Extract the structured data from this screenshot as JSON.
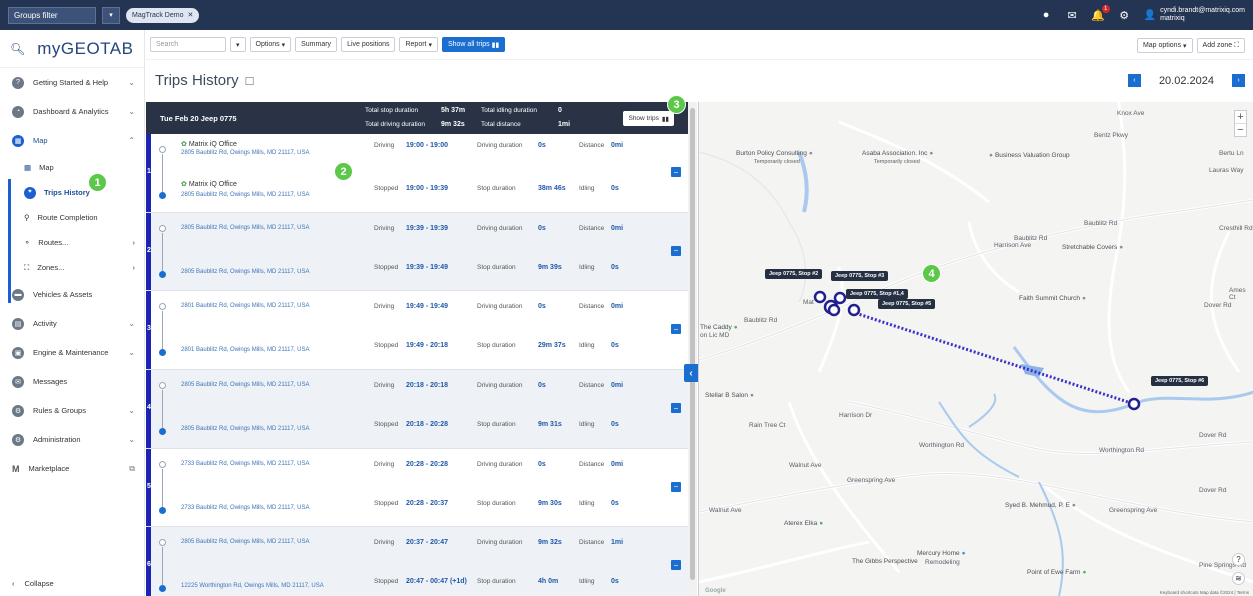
{
  "topbar": {
    "groups_filter": "Groups filter",
    "chip": "MagTrack Demo",
    "user_email": "cyndi.brandt@matrixiq.com",
    "user_org": "matrixiq",
    "notif_count": "1"
  },
  "logo": {
    "brand": "myGEOTAB",
    "tm": "™"
  },
  "sidebar": {
    "items": [
      {
        "label": "Getting Started & Help",
        "icon": "help-icon"
      },
      {
        "label": "Dashboard & Analytics",
        "icon": "dashboard-icon"
      },
      {
        "label": "Map",
        "icon": "map-icon"
      }
    ],
    "map_sub": [
      {
        "label": "Map"
      },
      {
        "label": "Trips History"
      },
      {
        "label": "Route Completion"
      },
      {
        "label": "Routes..."
      },
      {
        "label": "Zones..."
      }
    ],
    "items2": [
      {
        "label": "Vehicles & Assets"
      },
      {
        "label": "Activity"
      },
      {
        "label": "Engine & Maintenance"
      },
      {
        "label": "Messages"
      },
      {
        "label": "Rules & Groups"
      },
      {
        "label": "Administration"
      },
      {
        "label": "Marketplace"
      }
    ],
    "collapse": "Collapse"
  },
  "toolbar": {
    "search_placeholder": "Search",
    "options": "Options",
    "summary": "Summary",
    "live": "Live positions",
    "report": "Report",
    "show_all": "Show all trips",
    "map_options": "Map options",
    "add_zone": "Add zone"
  },
  "page": {
    "title": "Trips History",
    "date": "20.02.2024"
  },
  "panel": {
    "date_vehicle": "Tue Feb 20  Jeep 0775",
    "stats": {
      "stop_label": "Total stop duration",
      "stop_val": "5h 37m",
      "idle_label": "Total idling duration",
      "idle_val": "0",
      "drive_label": "Total driving duration",
      "drive_val": "9m 32s",
      "dist_label": "Total distance",
      "dist_val": "1mi"
    },
    "show_trips": "Show trips"
  },
  "labels": {
    "driving": "Driving",
    "stopped": "Stopped",
    "driving_duration": "Driving duration",
    "stop_duration": "Stop duration",
    "distance": "Distance",
    "idling": "Idling"
  },
  "trips": [
    {
      "n": "1",
      "start_name": "Matrix iQ Office",
      "start_addr": "2805 Baublitz Rd, Owings Mills, MD 21117, USA",
      "drive_time": "19:00 - 19:00",
      "drive_dur": "0s",
      "dist": "0mi",
      "end_name": "Matrix iQ Office",
      "end_addr": "2805 Baublitz Rd, Owings Mills, MD 21117, USA",
      "stop_time": "19:00 - 19:39",
      "stop_dur": "38m 46s",
      "idle": "0s"
    },
    {
      "n": "2",
      "start_name": "",
      "start_addr": "2805 Baublitz Rd, Owings Mills, MD 21117, USA",
      "drive_time": "19:39 - 19:39",
      "drive_dur": "0s",
      "dist": "0mi",
      "end_name": "",
      "end_addr": "2805 Baublitz Rd, Owings Mills, MD 21117, USA",
      "stop_time": "19:39 - 19:49",
      "stop_dur": "9m 39s",
      "idle": "0s"
    },
    {
      "n": "3",
      "start_name": "",
      "start_addr": "2801 Baublitz Rd, Owings Mills, MD 21117, USA",
      "drive_time": "19:49 - 19:49",
      "drive_dur": "0s",
      "dist": "0mi",
      "end_name": "",
      "end_addr": "2801 Baublitz Rd, Owings Mills, MD 21117, USA",
      "stop_time": "19:49 - 20:18",
      "stop_dur": "29m 37s",
      "idle": "0s"
    },
    {
      "n": "4",
      "start_name": "",
      "start_addr": "2805 Baublitz Rd, Owings Mills, MD 21117, USA",
      "drive_time": "20:18 - 20:18",
      "drive_dur": "0s",
      "dist": "0mi",
      "end_name": "",
      "end_addr": "2805 Baublitz Rd, Owings Mills, MD 21117, USA",
      "stop_time": "20:18 - 20:28",
      "stop_dur": "9m 31s",
      "idle": "0s"
    },
    {
      "n": "5",
      "start_name": "",
      "start_addr": "2733 Baublitz Rd, Owings Mills, MD 21117, USA",
      "drive_time": "20:28 - 20:28",
      "drive_dur": "0s",
      "dist": "0mi",
      "end_name": "",
      "end_addr": "2733 Baublitz Rd, Owings Mills, MD 21117, USA",
      "stop_time": "20:28 - 20:37",
      "stop_dur": "9m 30s",
      "idle": "0s"
    },
    {
      "n": "6",
      "start_name": "",
      "start_addr": "2805 Baublitz Rd, Owings Mills, MD 21117, USA",
      "drive_time": "20:37 - 20:47",
      "drive_dur": "9m 32s",
      "dist": "1mi",
      "end_name": "",
      "end_addr": "12225 Worthington Rd, Owings Mills, MD 21117, USA",
      "stop_time": "20:47 - 00:47 (+1d)",
      "stop_dur": "4h 0m",
      "idle": "0s"
    }
  ],
  "callouts": [
    "1",
    "2",
    "3",
    "4"
  ],
  "map": {
    "stops": [
      "Jeep 0775, Stop #2",
      "Jeep 0775, Stop #3",
      "Jeep 0775, Stop #1,4",
      "Jeep 0775, Stop #5",
      "Jeep 0775, Stop #6"
    ],
    "roads": [
      "Knox Ave",
      "Baublitz Rd",
      "Baublitz Rd",
      "Baublitz Rd",
      "Cresthill Rd",
      "Dover Rd",
      "Worthington Rd",
      "Worthington Rd",
      "Greenspring Ave",
      "Greenspring Ave",
      "Walnut Ave",
      "Walnut Ave",
      "Rain Tree Ct",
      "Bertu Ln",
      "Bentz Pkwy",
      "Dover Rd",
      "Dover Rd",
      "Harrison Dr",
      "Harrison Ave",
      "Pine Springs Rd",
      "Ames Ct",
      "Lauras Way"
    ],
    "pois": [
      "Burton Policy Consulting",
      "Temporarily closed",
      "Asaba Association, Inc",
      "Temporarily closed",
      "Business Valuation Group",
      "Stretchable Covers",
      "Faith Summit Church",
      "The Caddy",
      "on Lic MD",
      "Stellar B Salon",
      "Syed B. Mehmud, P. E",
      "Aterex Elka",
      "The Gibbs Perspective",
      "Mercury Home",
      "Remodeling",
      "Point of Ewe Farm",
      "Mat"
    ],
    "footer": "Keyboard shortcuts   Map data ©2024 | Terms"
  },
  "colors": {
    "topbar": "#243553",
    "accent": "#1a6ecf",
    "trip_num": "#1d24b5",
    "callout": "#5cc84a",
    "route": "#3b31c9"
  }
}
